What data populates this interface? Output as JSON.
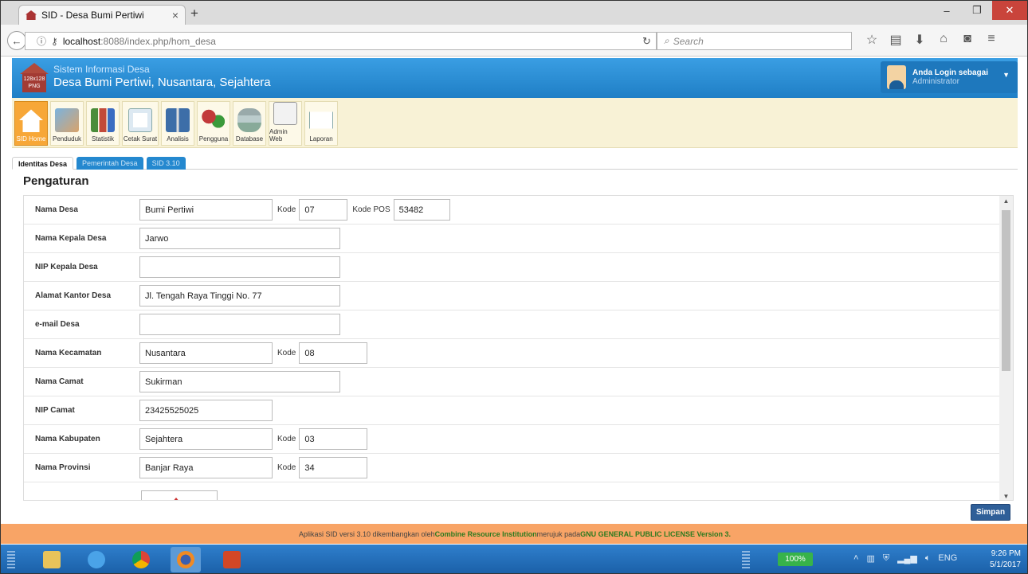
{
  "browser": {
    "tab_title": "SID - Desa Bumi Pertiwi",
    "tab_close": "×",
    "new_tab": "+",
    "url_host": "localhost",
    "url_path": ":8088/index.php/hom_desa",
    "search_placeholder": "Search"
  },
  "header": {
    "logo_text": "128x128 PNG",
    "system_name": "Sistem Informasi Desa",
    "desa_title": "Desa Bumi Pertiwi, Nusantara, Sejahtera",
    "login_label": "Anda Login sebagai",
    "role": "Administrator"
  },
  "toolbar": {
    "items": [
      "SID Home",
      "Penduduk",
      "Statistik",
      "Cetak Surat",
      "Analisis",
      "Pengguna",
      "Database",
      "Admin Web",
      "Laporan"
    ]
  },
  "subtabs": [
    "Identitas Desa",
    "Pemerintah Desa",
    "SID 3.10"
  ],
  "page_heading": "Pengaturan",
  "form": {
    "nama_desa": {
      "label": "Nama Desa",
      "value": "Bumi Pertiwi",
      "kode_label": "Kode",
      "kode": "07",
      "pos_label": "Kode POS",
      "pos": "53482"
    },
    "kepala_desa": {
      "label": "Nama Kepala Desa",
      "value": "Jarwo"
    },
    "nip_kepala": {
      "label": "NIP Kepala Desa",
      "value": ""
    },
    "alamat": {
      "label": "Alamat Kantor Desa",
      "value": "Jl. Tengah Raya Tinggi No. 77"
    },
    "email": {
      "label": "e-mail Desa",
      "value": ""
    },
    "kecamatan": {
      "label": "Nama Kecamatan",
      "value": "Nusantara",
      "kode_label": "Kode",
      "kode": "08"
    },
    "camat": {
      "label": "Nama Camat",
      "value": "Sukirman"
    },
    "nip_camat": {
      "label": "NIP Camat",
      "value": "23425525025"
    },
    "kabupaten": {
      "label": "Nama Kabupaten",
      "value": "Sejahtera",
      "kode_label": "Kode",
      "kode": "03"
    },
    "provinsi": {
      "label": "Nama Provinsi",
      "value": "Banjar Raya",
      "kode_label": "Kode",
      "kode": "34"
    }
  },
  "save_button": "Simpan",
  "footer": {
    "pre": "Aplikasi SID versi 3.10 dikembangkan oleh ",
    "org": "Combine Resource Institution",
    "mid": " merujuk pada ",
    "license": "GNU GENERAL PUBLIC LICENSE Version 3."
  },
  "taskbar": {
    "battery": "100%",
    "lang": "ENG",
    "time": "9:26 PM",
    "date": "5/1/2017"
  }
}
